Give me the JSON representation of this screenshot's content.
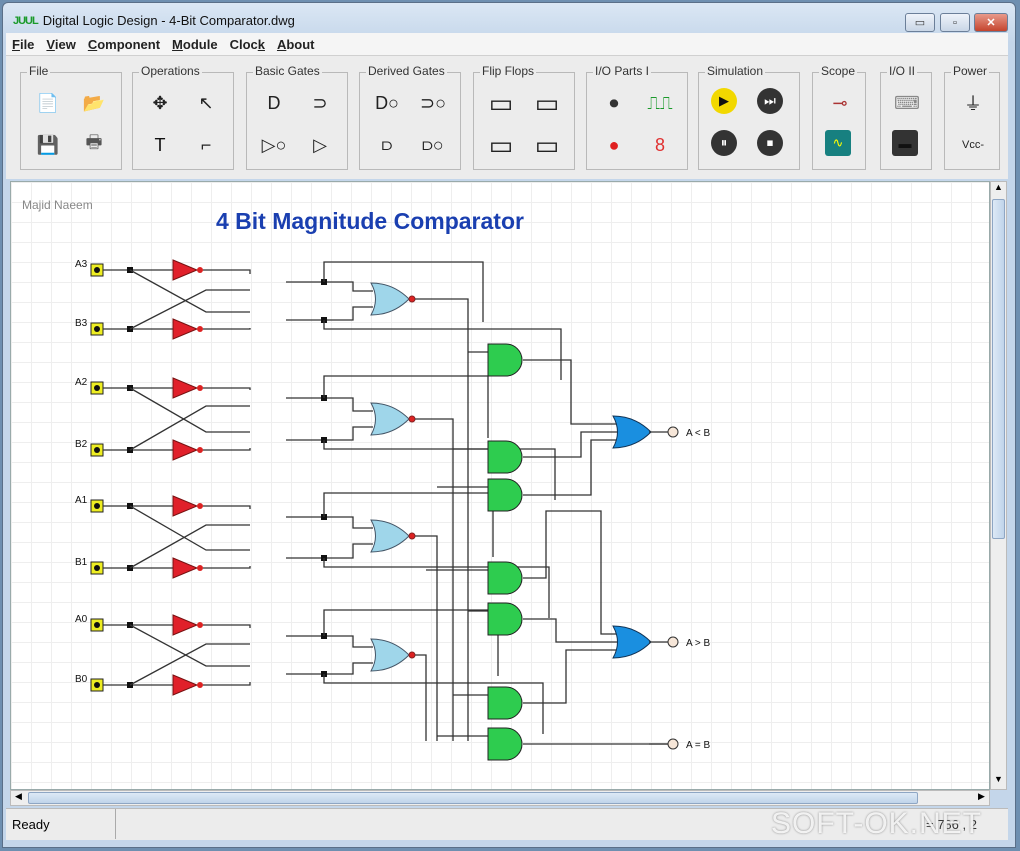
{
  "window": {
    "title": "Digital Logic Design - 4-Bit Comparator.dwg",
    "logo": "JUUL",
    "minimize": "▭",
    "maximize": "▫",
    "close": "✕"
  },
  "menu": [
    {
      "key": "F",
      "rest": "ile"
    },
    {
      "key": "V",
      "rest": "iew"
    },
    {
      "key": "C",
      "rest": "omponent"
    },
    {
      "key": "M",
      "rest": "odule"
    },
    {
      "pre": "Cloc",
      "key": "k",
      "rest": ""
    },
    {
      "key": "A",
      "rest": "bout"
    }
  ],
  "toolbar": {
    "groups": [
      {
        "label": "File",
        "items": [
          "new-file-icon",
          "open-folder-icon",
          "save-icon",
          "print-icon"
        ]
      },
      {
        "label": "Operations",
        "items": [
          "move-icon",
          "pointer-icon",
          "text-icon",
          "wire-icon"
        ]
      },
      {
        "label": "Basic Gates",
        "items": [
          "and-gate-icon",
          "or-gate-icon",
          "not-gate-icon",
          "buffer-icon"
        ]
      },
      {
        "label": "Derived Gates",
        "items": [
          "nand-gate-icon",
          "nor-gate-icon",
          "xor-gate-icon",
          "xnor-gate-icon"
        ]
      },
      {
        "label": "Flip Flops",
        "items": [
          "sr-flipflop-icon",
          "jk-flipflop-icon",
          "d-flipflop-icon",
          "t-flipflop-icon"
        ]
      },
      {
        "label": "I/O Parts I",
        "items": [
          "push-button-icon",
          "clock-pulse-icon",
          "led-icon",
          "seven-segment-icon"
        ]
      },
      {
        "label": "Simulation",
        "items": [
          "play-icon",
          "step-icon",
          "pause-icon",
          "stop-icon"
        ]
      },
      {
        "label": "Scope",
        "items": [
          "probe-icon",
          "oscilloscope-icon"
        ]
      },
      {
        "label": "I/O II",
        "items": [
          "keyboard-icon",
          "terminal-icon"
        ]
      },
      {
        "label": "Power",
        "items": [
          "ground-icon",
          "vcc-icon"
        ]
      }
    ],
    "vcc_label": "Vcc-"
  },
  "canvas": {
    "author": "Majid Naeem",
    "title": "4 Bit Magnitude Comparator",
    "title_color": "#1a3fb0",
    "inputs": [
      "A3",
      "B3",
      "A2",
      "B2",
      "A1",
      "B1",
      "A0",
      "B0"
    ],
    "outputs": [
      "A < B",
      "A > B",
      "A = B"
    ],
    "colors": {
      "and": "#2ecc4f",
      "xnor": "#9fd6ea",
      "or": "#1a8fe0",
      "not": "#e0202a"
    }
  },
  "status": {
    "text": "Ready",
    "coords": "= 786 , 2"
  },
  "watermark": "SOFT-OK.NET"
}
